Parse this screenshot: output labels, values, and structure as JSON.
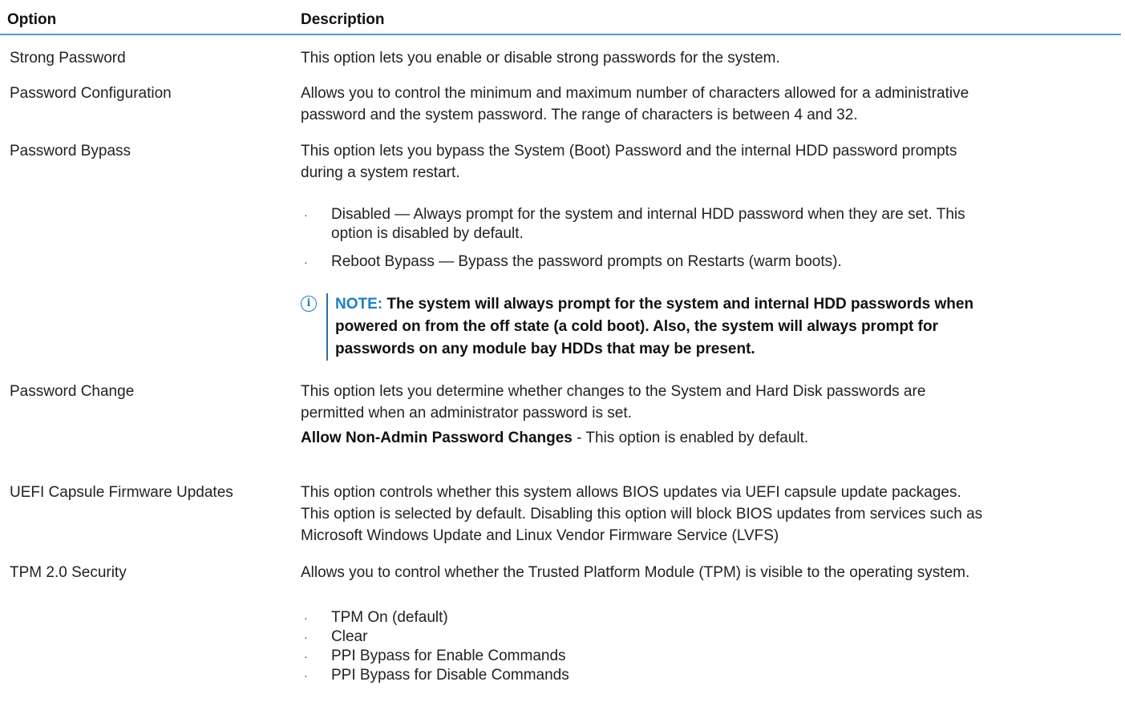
{
  "table": {
    "header": {
      "option": "Option",
      "description": "Description"
    },
    "rows": [
      {
        "option": "Strong Password",
        "description": "This option lets you enable or disable strong passwords for the system."
      },
      {
        "option": "Password Configuration",
        "description_lines": [
          "Allows you to control the minimum and maximum number of characters allowed for a administrative",
          "password and the system password. The range of characters is between 4 and 32."
        ]
      },
      {
        "option": "Password Bypass",
        "description_lines": [
          "This option lets you bypass the System (Boot) Password and the internal HDD password prompts",
          "during a system restart."
        ],
        "bullets": [
          [
            "Disabled — Always prompt for the system and internal HDD password when they are set. This",
            "option is disabled by default."
          ],
          [
            "Reboot Bypass — Bypass the password prompts on Restarts (warm boots)."
          ]
        ],
        "note": {
          "label": "NOTE:",
          "lines": [
            "The system will always prompt for the system and internal HDD passwords when",
            "powered on from the off state (a cold boot). Also, the system will always prompt for",
            "passwords on any module bay HDDs that may be present."
          ]
        }
      },
      {
        "option": "Password Change",
        "description_lines": [
          "This option lets you determine whether changes to the System and Hard Disk passwords are",
          "permitted when an administrator password is set."
        ],
        "setting_name": "Allow Non-Admin Password Changes",
        "setting_text": " - This option is enabled by default."
      },
      {
        "option": "UEFI Capsule Firmware Updates",
        "description_lines": [
          "This option controls whether this system allows BIOS updates via UEFI capsule update packages.",
          "This option is selected by default. Disabling this option will block BIOS updates from services such as",
          "Microsoft Windows Update and Linux Vendor Firmware Service (LVFS)"
        ]
      },
      {
        "option": "TPM 2.0 Security",
        "description": "Allows you to control whether the Trusted Platform Module (TPM) is visible to the operating system.",
        "bullets": [
          "TPM On (default)",
          "Clear",
          "PPI Bypass for Enable Commands",
          "PPI Bypass for Disable Commands"
        ]
      }
    ]
  },
  "icons": {
    "note": "info-circle-icon",
    "bullet": "·"
  },
  "colors": {
    "accent": "#1e7fc0",
    "header_rule": "#4f9bc9"
  }
}
